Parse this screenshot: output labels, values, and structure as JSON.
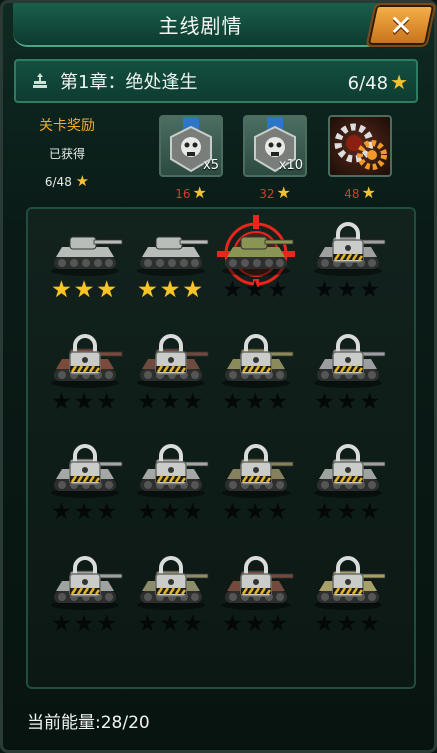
{
  "window": {
    "title": "主线剧情",
    "close_label": "✕"
  },
  "chapter": {
    "name": "第1章：绝处逢生",
    "progress": "6/48",
    "progress_star": "★"
  },
  "rewards": {
    "title": "关卡奖励",
    "status": "已获得",
    "progress": "6/48",
    "items": [
      {
        "icon": "skull-medal-icon",
        "quantity": "x5",
        "cost": "16",
        "star": "★"
      },
      {
        "icon": "skull-medal-icon",
        "quantity": "x10",
        "cost": "32",
        "star": "★"
      },
      {
        "icon": "gear-upgrade-icon",
        "quantity": "",
        "cost": "48",
        "star": "★"
      }
    ]
  },
  "levels": [
    {
      "tank_color": "#b9bdb9",
      "locked": false,
      "stars": 3,
      "selected": false
    },
    {
      "tank_color": "#b9bdb9",
      "locked": false,
      "stars": 3,
      "selected": false
    },
    {
      "tank_color": "#8a9553",
      "locked": false,
      "stars": 0,
      "selected": true
    },
    {
      "tank_color": "#9ea1a0",
      "locked": true,
      "stars": 0,
      "selected": false
    },
    {
      "tank_color": "#7a4a3a",
      "locked": true,
      "stars": 0,
      "selected": false
    },
    {
      "tank_color": "#6f4b3f",
      "locked": true,
      "stars": 0,
      "selected": false
    },
    {
      "tank_color": "#8c8a5a",
      "locked": true,
      "stars": 0,
      "selected": false
    },
    {
      "tank_color": "#9b9da0",
      "locked": true,
      "stars": 0,
      "selected": false
    },
    {
      "tank_color": "#a4a7a3",
      "locked": true,
      "stars": 0,
      "selected": false
    },
    {
      "tank_color": "#a4a7a3",
      "locked": true,
      "stars": 0,
      "selected": false
    },
    {
      "tank_color": "#86815c",
      "locked": true,
      "stars": 0,
      "selected": false
    },
    {
      "tank_color": "#9fa39f",
      "locked": true,
      "stars": 0,
      "selected": false
    },
    {
      "tank_color": "#9fa39f",
      "locked": true,
      "stars": 0,
      "selected": false
    },
    {
      "tank_color": "#8d8c6a",
      "locked": true,
      "stars": 0,
      "selected": false
    },
    {
      "tank_color": "#744a3c",
      "locked": true,
      "stars": 0,
      "selected": false
    },
    {
      "tank_color": "#a8a067",
      "locked": true,
      "stars": 0,
      "selected": false
    }
  ],
  "energy": {
    "label": "当前能量:28/20"
  },
  "colors": {
    "gold_star": "#f7c52a",
    "cost_red": "#d93a2f",
    "accent_green": "#2e7d63",
    "close_orange": "#f7b24a"
  }
}
